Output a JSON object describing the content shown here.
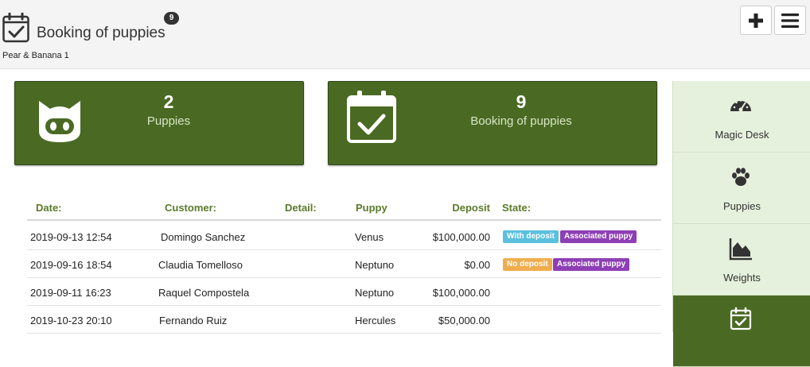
{
  "header": {
    "title": "Booking of puppies",
    "count_badge": "9",
    "subtitle": "Pear & Banana 1",
    "add_icon": "plus-icon",
    "menu_icon": "hamburger-icon"
  },
  "stats": [
    {
      "icon": "cat-face-icon",
      "value": "2",
      "label": "Puppies"
    },
    {
      "icon": "calendar-check-icon",
      "value": "9",
      "label": "Booking of puppies"
    }
  ],
  "table": {
    "columns": [
      "Date:",
      "Customer:",
      "Detail:",
      "Puppy",
      "Deposit",
      "State:"
    ],
    "rows": [
      {
        "date": "2019-09-13 12:54",
        "customer": "Domingo Sanchez",
        "detail": "",
        "puppy": "Venus",
        "deposit": "$100,000.00",
        "badges": [
          {
            "text": "With deposit",
            "color": "#5bc0de"
          },
          {
            "text": "Associated puppy",
            "color": "#8e3fb5"
          }
        ]
      },
      {
        "date": "2019-09-16 18:54",
        "customer": "Claudia Tomelloso",
        "detail": "",
        "puppy": "Neptuno",
        "deposit": "$0.00",
        "badges": [
          {
            "text": "No deposit",
            "color": "#f0ad4e"
          },
          {
            "text": "Associated puppy",
            "color": "#8e3fb5"
          }
        ]
      },
      {
        "date": "2019-09-11 16:23",
        "customer": "Raquel Compostela",
        "detail": "",
        "puppy": "Neptuno",
        "deposit": "$100,000.00",
        "badges": []
      },
      {
        "date": "2019-10-23 20:10",
        "customer": "Fernando Ruiz",
        "detail": "",
        "puppy": "Hercules",
        "deposit": "$50,000.00",
        "badges": []
      }
    ]
  },
  "sidebar": {
    "items": [
      {
        "label": "Magic Desk",
        "icon": "dashboard-gauge-icon"
      },
      {
        "label": "Puppies",
        "icon": "paw-icon"
      },
      {
        "label": "Weights",
        "icon": "area-chart-icon"
      },
      {
        "label": "",
        "icon": "calendar-check-icon",
        "active": true
      }
    ]
  },
  "colors": {
    "accent_green": "#4a6a24",
    "header_text_green": "#5a7a2a",
    "sidebar_bg": "#e6f1dd",
    "badge_blue": "#5bc0de",
    "badge_orange": "#f0ad4e",
    "badge_purple": "#8e3fb5"
  }
}
